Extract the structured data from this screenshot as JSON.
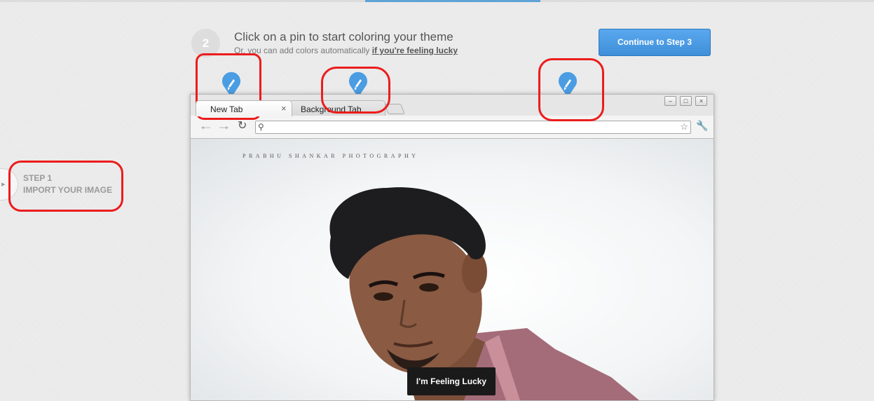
{
  "colors": {
    "accent_blue": "#4a9ee6",
    "annotation_red": "#ec1c1c",
    "pin_blue": "#4a9de2",
    "dark_button": "#1a1a1a"
  },
  "step2": {
    "number": "2",
    "title": "Click on a pin to start coloring your theme",
    "subtitle_prefix": "Or, you can add colors automatically ",
    "lucky_link": "if you're feeling lucky"
  },
  "continue_button": "Continue to Step 3",
  "step1": {
    "line1": "STEP 1",
    "line2": "IMPORT YOUR IMAGE"
  },
  "pins": [
    {
      "icon": "paintbrush-pin-icon",
      "target": "frame"
    },
    {
      "icon": "paintbrush-pin-icon",
      "target": "background-tab"
    },
    {
      "icon": "paintbrush-pin-icon",
      "target": "toolbar"
    }
  ],
  "browser": {
    "tabs": [
      {
        "label": "New Tab",
        "active": true
      },
      {
        "label": "Background Tab",
        "active": false
      }
    ],
    "window_controls": [
      "minimize-icon",
      "maximize-icon",
      "close-icon"
    ],
    "toolbar_icons": [
      "back-arrow-icon",
      "forward-arrow-icon",
      "reload-icon",
      "search-icon",
      "star-icon",
      "wrench-icon"
    ],
    "address_value": "",
    "watermark": "PRABHU SHANKAR PHOTOGRAPHY"
  },
  "feeling_lucky_button": "I'm Feeling Lucky"
}
